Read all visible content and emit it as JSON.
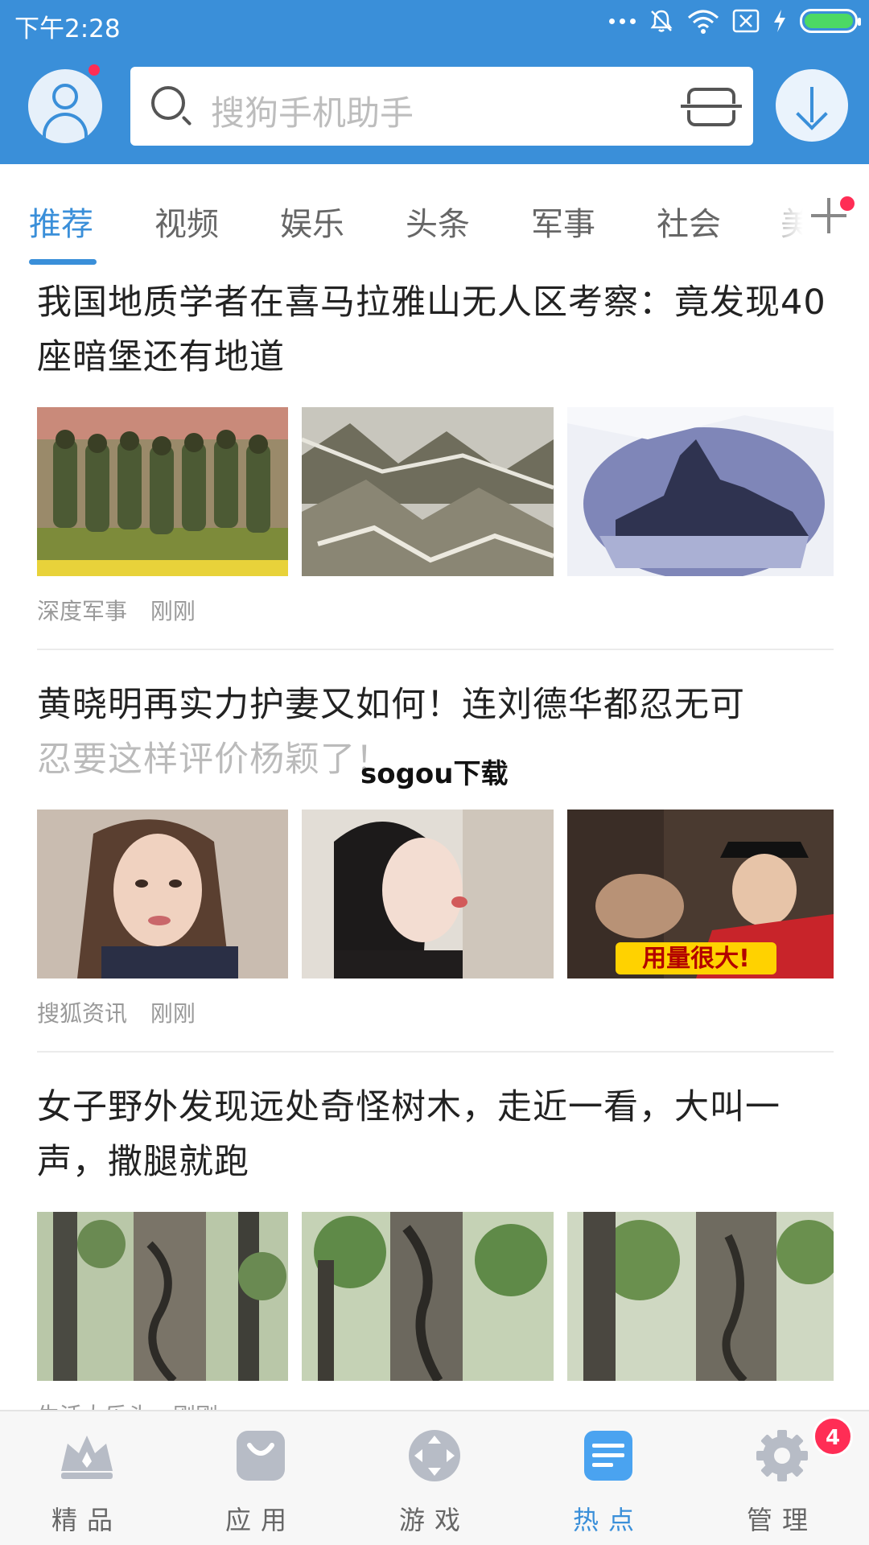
{
  "status_bar": {
    "time": "下午2:28",
    "icons": [
      "more-dots-icon",
      "bell-mute-icon",
      "wifi-icon",
      "sim-icon",
      "charging-icon",
      "battery-icon"
    ]
  },
  "header": {
    "search_placeholder": "搜狗手机助手",
    "colors": {
      "header_bg": "#3a8fd9",
      "accent": "#3a8fd9",
      "badge": "#ff2d55"
    }
  },
  "tabs": {
    "items": [
      {
        "label": "推荐",
        "active": true
      },
      {
        "label": "视频",
        "active": false
      },
      {
        "label": "娱乐",
        "active": false
      },
      {
        "label": "头条",
        "active": false
      },
      {
        "label": "军事",
        "active": false
      },
      {
        "label": "社会",
        "active": false
      },
      {
        "label": "美",
        "active": false
      }
    ]
  },
  "feed": {
    "items": [
      {
        "title": "我国地质学者在喜马拉雅山无人区考察：竟发现40座暗堡还有地道",
        "source": "深度军事",
        "time": "刚刚",
        "images": [
          "marching-soldiers",
          "mountain-satellite",
          "glacier-peak"
        ]
      },
      {
        "title_line1": "黄晓明再实力护妻又如何！连刘德华都忍无可",
        "title_line2": "忍要这样评价杨颖了！",
        "source": "搜狐资讯",
        "time": "刚刚",
        "images": [
          "woman-portrait",
          "woman-kiss",
          "tv-show-screenshot"
        ],
        "image_caption": "用量很大!"
      },
      {
        "title": "女子野外发现远处奇怪树木，走近一看，大叫一声，撒腿就跑",
        "source": "生活大乐头",
        "time": "刚刚",
        "images": [
          "forest-tree-1",
          "forest-tree-2",
          "forest-tree-3"
        ]
      }
    ]
  },
  "watermark": "sogou下载",
  "bottom_nav": {
    "items": [
      {
        "label": "精品",
        "icon": "crown-icon",
        "active": false
      },
      {
        "label": "应用",
        "icon": "bag-icon",
        "active": false
      },
      {
        "label": "游戏",
        "icon": "gamepad-icon",
        "active": false
      },
      {
        "label": "热点",
        "icon": "news-icon",
        "active": true
      },
      {
        "label": "管理",
        "icon": "gear-icon",
        "active": false
      }
    ],
    "manage_badge": "4"
  }
}
